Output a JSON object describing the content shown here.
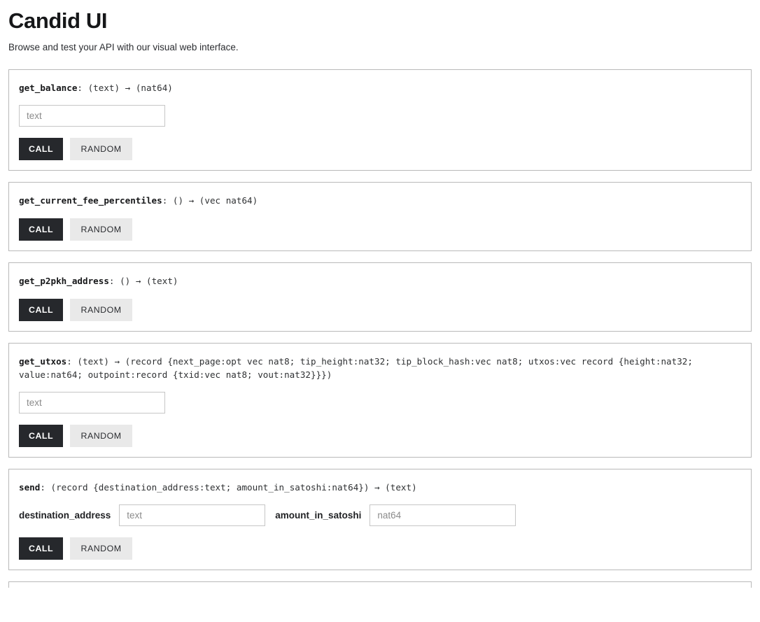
{
  "header": {
    "title": "Candid UI",
    "subtitle": "Browse and test your API with our visual web interface."
  },
  "buttons": {
    "call_label": "CALL",
    "random_label": "RANDOM"
  },
  "colors": {
    "call_button_bg": "#26282c",
    "random_button_bg": "#e9e9e9",
    "card_border": "#b9b9b9",
    "input_border": "#c6c6c6",
    "placeholder_text": "#8b8b8b",
    "page_bg": "#ffffff"
  },
  "methods": [
    {
      "name": "get_balance",
      "separator": ": ",
      "signature_rest": "(text) → (nat64)",
      "args": [
        {
          "label": "",
          "placeholder": "text",
          "value": "",
          "width_class": "w-solo"
        }
      ]
    },
    {
      "name": "get_current_fee_percentiles",
      "separator": ": ",
      "signature_rest": "() → (vec nat64)",
      "args": []
    },
    {
      "name": "get_p2pkh_address",
      "separator": ": ",
      "signature_rest": "() → (text)",
      "args": []
    },
    {
      "name": "get_utxos",
      "separator": ": ",
      "signature_rest": "(text) → (record {next_page:opt vec nat8; tip_height:nat32; tip_block_hash:vec nat8; utxos:vec record {height:nat32; value:nat64; outpoint:record {txid:vec nat8; vout:nat32}}})",
      "args": [
        {
          "label": "",
          "placeholder": "text",
          "value": "",
          "width_class": "w-solo"
        }
      ]
    },
    {
      "name": "send",
      "separator": ": ",
      "signature_rest": "(record {destination_address:text; amount_in_satoshi:nat64}) → (text)",
      "args": [
        {
          "label": "destination_address",
          "placeholder": "text",
          "value": "",
          "width_class": "w-dest"
        },
        {
          "label": "amount_in_satoshi",
          "placeholder": "nat64",
          "value": "",
          "width_class": "w-amt"
        }
      ]
    }
  ]
}
